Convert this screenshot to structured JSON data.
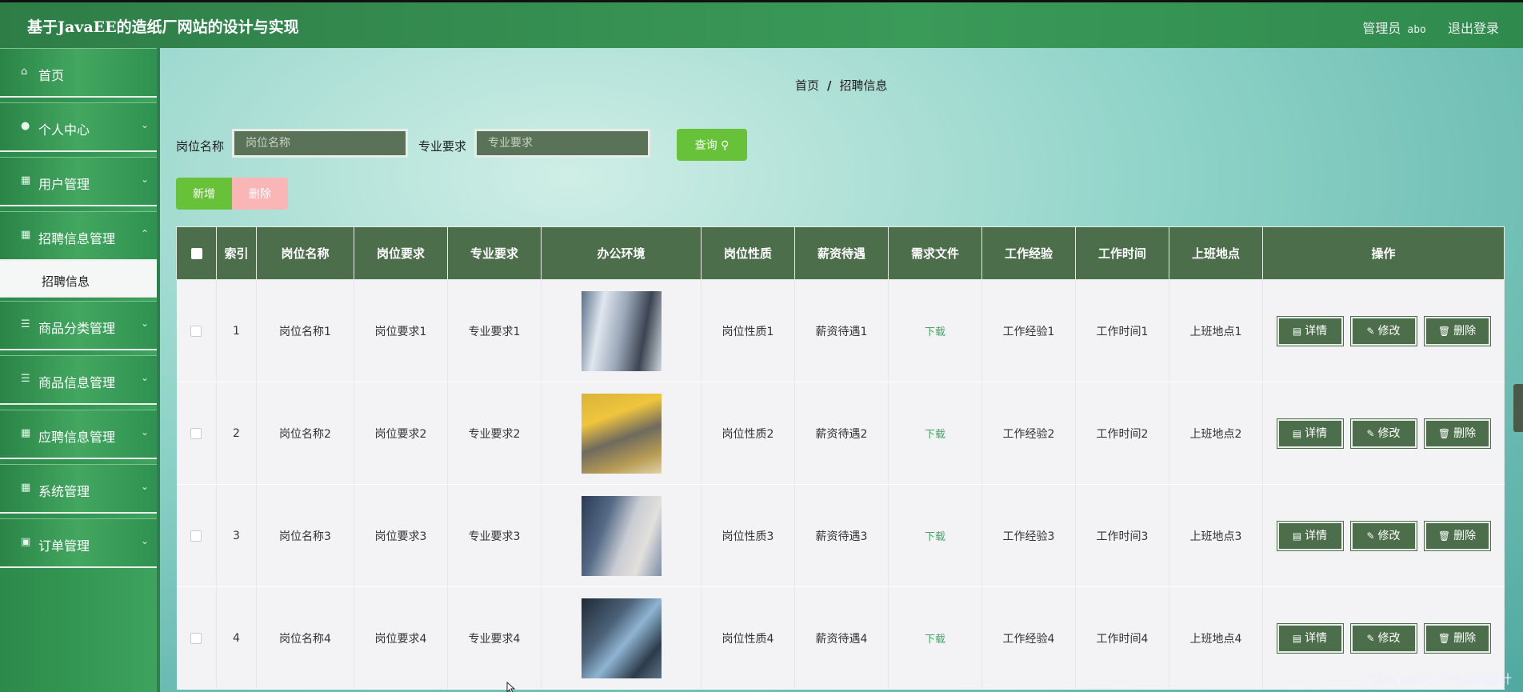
{
  "header": {
    "title": "基于JavaEE的造纸厂网站的设计与实现",
    "role": "管理员",
    "user": "abo",
    "logout": "退出登录"
  },
  "sidebar": {
    "items": [
      {
        "label": "首页",
        "icon": "home-icon",
        "glyph": "⌂",
        "chevron": false
      },
      {
        "label": "个人中心",
        "icon": "user-icon",
        "glyph": "●",
        "chevron": true
      },
      {
        "label": "用户管理",
        "icon": "grid-icon",
        "glyph": "▦",
        "chevron": true
      },
      {
        "label": "招聘信息管理",
        "icon": "grid-icon",
        "glyph": "▦",
        "chevron": true
      },
      {
        "label": "商品分类管理",
        "icon": "list-icon",
        "glyph": "☰",
        "chevron": true
      },
      {
        "label": "商品信息管理",
        "icon": "list-icon",
        "glyph": "☰",
        "chevron": true
      },
      {
        "label": "应聘信息管理",
        "icon": "grid-icon",
        "glyph": "▦",
        "chevron": true
      },
      {
        "label": "系统管理",
        "icon": "grid-icon",
        "glyph": "▦",
        "chevron": true
      },
      {
        "label": "订单管理",
        "icon": "clipboard-icon",
        "glyph": "▣",
        "chevron": true
      }
    ],
    "submenu": "招聘信息"
  },
  "breadcrumb": {
    "home": "首页",
    "sep": "/",
    "current": "招聘信息"
  },
  "search": {
    "field1_label": "岗位名称",
    "field1_placeholder": "岗位名称",
    "field2_label": "专业要求",
    "field2_placeholder": "专业要求",
    "query_label": "查询 ⚲"
  },
  "actions": {
    "add": "新增",
    "delete": "删除"
  },
  "table": {
    "headers": [
      "索引",
      "岗位名称",
      "岗位要求",
      "专业要求",
      "办公环境",
      "岗位性质",
      "薪资待遇",
      "需求文件",
      "工作经验",
      "工作时间",
      "上班地点",
      "操作"
    ],
    "rows": [
      {
        "index": "1",
        "name": "岗位名称1",
        "req": "岗位要求1",
        "major": "专业要求1",
        "nature": "岗位性质1",
        "salary": "薪资待遇1",
        "file": "下载",
        "exp": "工作经验1",
        "time": "工作时间1",
        "place": "上班地点1"
      },
      {
        "index": "2",
        "name": "岗位名称2",
        "req": "岗位要求2",
        "major": "专业要求2",
        "nature": "岗位性质2",
        "salary": "薪资待遇2",
        "file": "下载",
        "exp": "工作经验2",
        "time": "工作时间2",
        "place": "上班地点2"
      },
      {
        "index": "3",
        "name": "岗位名称3",
        "req": "岗位要求3",
        "major": "专业要求3",
        "nature": "岗位性质3",
        "salary": "薪资待遇3",
        "file": "下载",
        "exp": "工作经验3",
        "time": "工作时间3",
        "place": "上班地点3"
      },
      {
        "index": "4",
        "name": "岗位名称4",
        "req": "岗位要求4",
        "major": "专业要求4",
        "nature": "岗位性质4",
        "salary": "薪资待遇4",
        "file": "下载",
        "exp": "工作经验4",
        "time": "工作时间4",
        "place": "上班地点4"
      }
    ],
    "ops": {
      "detail": "详情",
      "edit": "修改",
      "delete": "删除"
    }
  },
  "watermark": "CSDN @php-毕业源码设计",
  "colors": {
    "accent": "#67c23a",
    "table_header": "#4d6e4b",
    "danger_light": "#fab6b6"
  }
}
